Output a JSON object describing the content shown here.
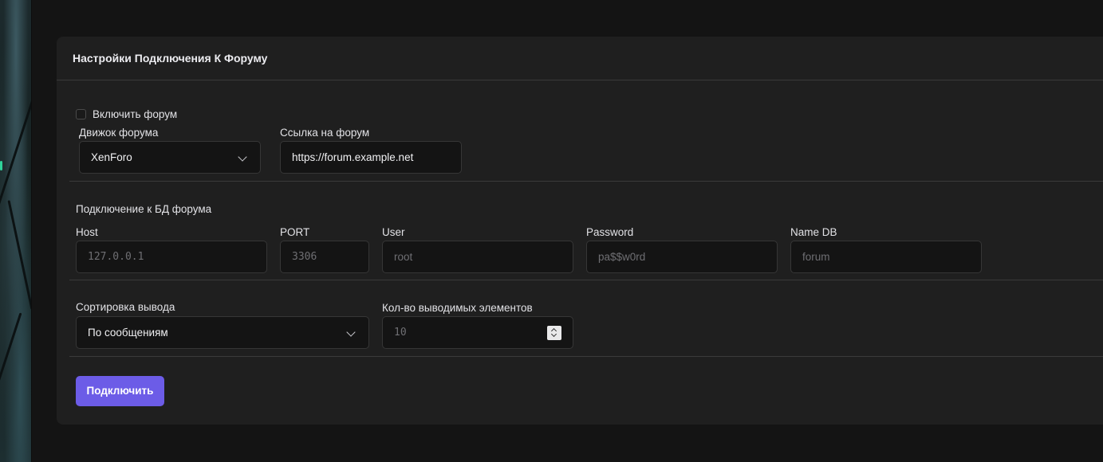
{
  "card": {
    "title": "Настройки Подключения К Форуму"
  },
  "forum": {
    "enable_label": "Включить форум",
    "enabled": false,
    "engine_label": "Движок форума",
    "engine_value": "XenForo",
    "url_label": "Ссылка на форум",
    "url_value": "https://forum.example.net"
  },
  "db": {
    "section_label": "Подключение к БД форума",
    "host_label": "Host",
    "host_placeholder": "127.0.0.1",
    "port_label": "PORT",
    "port_placeholder": "3306",
    "user_label": "User",
    "user_placeholder": "root",
    "password_label": "Password",
    "password_placeholder": "pa$$w0rd",
    "name_label": "Name DB",
    "name_placeholder": "forum"
  },
  "output": {
    "sort_label": "Сортировка вывода",
    "sort_value": "По сообщениям",
    "count_label": "Кол-во выводимых элементов",
    "count_placeholder": "10"
  },
  "actions": {
    "connect_label": "Подключить"
  },
  "colors": {
    "accent": "#6c5ce7",
    "card_bg": "#1f1f1f",
    "page_bg": "#141414",
    "input_bg": "#141414"
  }
}
